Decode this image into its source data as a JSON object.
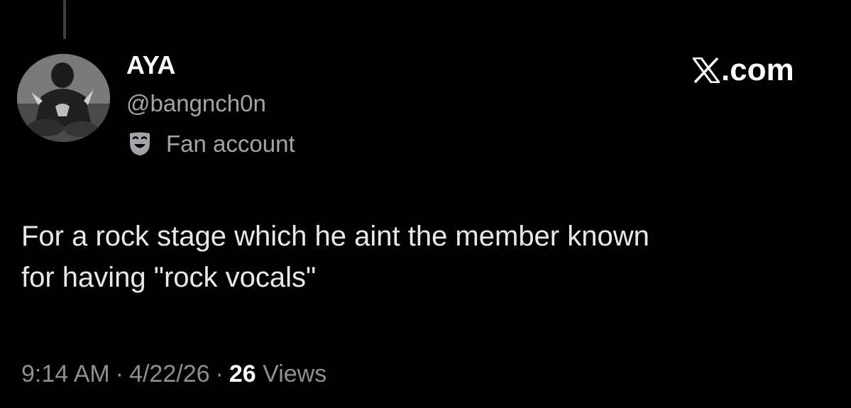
{
  "tweet": {
    "author": {
      "display_name": "AYA",
      "handle": "@bangnch0n",
      "label": "Fan account",
      "label_icon": "theater-masks-icon",
      "avatar": "avatar"
    },
    "brand": {
      "logo": "x-logo-icon",
      "text": ".com"
    },
    "text_lines": [
      "For a rock stage which he aint the member known",
      "for having \"rock vocals\""
    ],
    "meta": {
      "time": "9:14 AM",
      "separator": "·",
      "date": "4/22/26",
      "views_count": "26",
      "views_label": "Views"
    }
  },
  "colors": {
    "background": "#000000",
    "primary_text": "#e7e9ea",
    "secondary_text": "#a1a5aa",
    "thread_line": "#3e4144"
  }
}
